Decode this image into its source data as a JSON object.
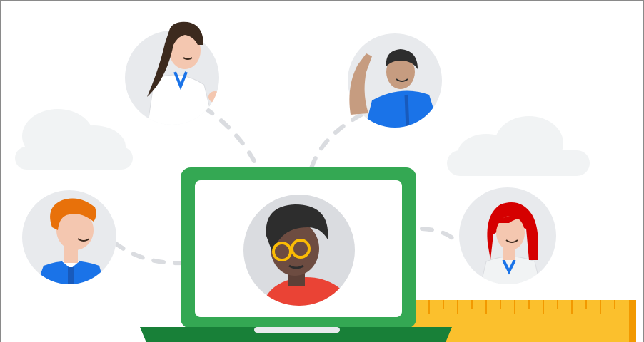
{
  "scene": {
    "background": "#ffffff",
    "colors": {
      "laptop_frame": "#34a853",
      "laptop_base": "#188038",
      "screen": "#ffffff",
      "avatar_bg": "#e8eaed",
      "cloud": "#f1f3f4",
      "dash": "#dadce0",
      "ruler": "#fbc02d",
      "ruler_marks": "#f29900",
      "shirt_blue": "#1a73e8",
      "shirt_white": "#ffffff",
      "shirt_red": "#ea4335",
      "hair_dark": "#3c2a1e",
      "hair_orange": "#e8710a",
      "hair_red": "#d50000",
      "glasses": "#fbbc04"
    },
    "icons": [
      "laptop-icon",
      "teacher-avatar",
      "student-avatar",
      "ruler-icon",
      "cloud-icon"
    ]
  }
}
